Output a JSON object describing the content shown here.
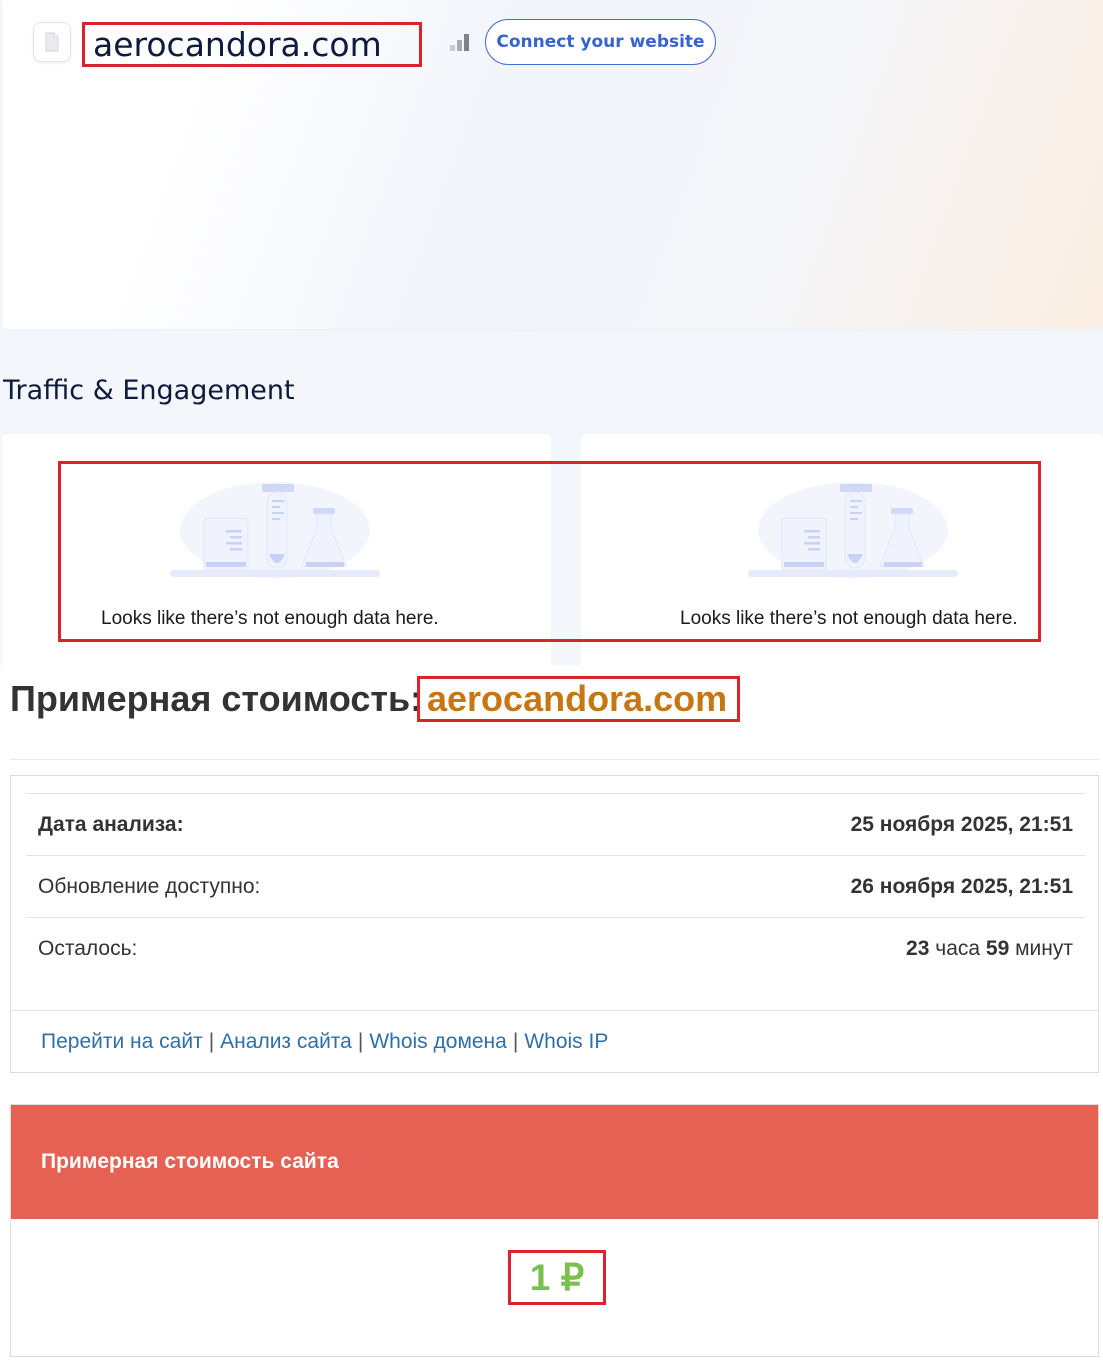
{
  "site": {
    "domain": "aerocandora.com",
    "connect_label": "Connect your website"
  },
  "traffic": {
    "section_title": "Traffic & Engagement",
    "cards": [
      {
        "message": "Looks like there’s not enough data here."
      },
      {
        "message": "Looks like there’s not enough data here."
      }
    ]
  },
  "valuation": {
    "heading": "Примерная стоимость:",
    "domain": "aerocandora.com",
    "rows": [
      {
        "key": "Дата анализа:",
        "value": "25 ноября 2025, 21:51"
      },
      {
        "key": "Обновление доступно:",
        "value": "26 ноября 2025, 21:51"
      },
      {
        "key": "Осталось:",
        "hours_num": "23",
        "hours_word": "часа",
        "min_num": "59",
        "min_word": "минут"
      }
    ],
    "links": [
      "Перейти на сайт",
      "Анализ сайта",
      "Whois домена",
      "Whois IP"
    ],
    "link_separator": "|",
    "cost_title": "Примерная стоимость сайта",
    "cost_value": "1 ₽"
  },
  "colors": {
    "accent_red": "#d9232d",
    "cost_header": "#e56153",
    "cost_value": "#7bbf4e",
    "domain_orange": "#c77712",
    "link_blue": "#2f6fa8"
  },
  "icons": [
    "file-icon",
    "rank-bars-icon",
    "lab-flasks-illustration"
  ]
}
